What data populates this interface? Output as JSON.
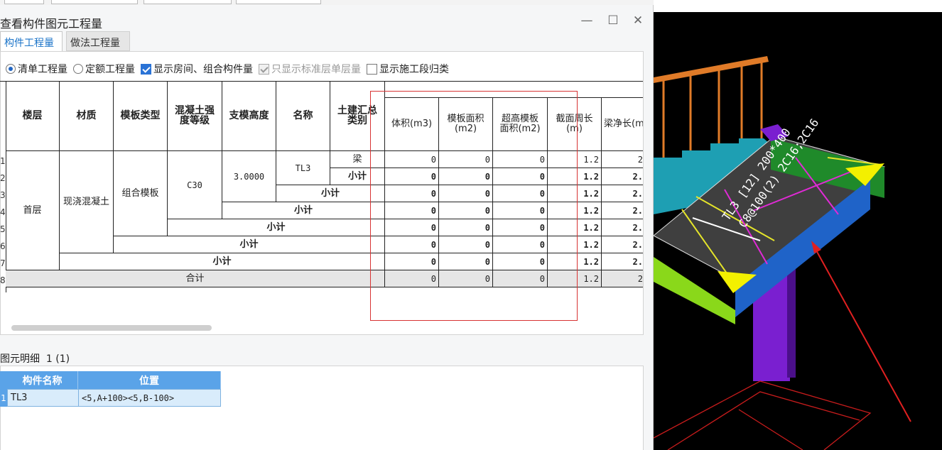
{
  "dialog": {
    "title": "查看构件图元工程量",
    "controls": {
      "minimize": "—",
      "maximize": "☐",
      "close": "✕"
    },
    "tabs": [
      "构件工程量",
      "做法工程量"
    ]
  },
  "options": {
    "radio_list": "清单工程量",
    "radio_quota": "定额工程量",
    "chk_show_room": "显示房间、组合构件量",
    "chk_std_floor": "只显示标准层单层量",
    "chk_construction": "显示施工段归类"
  },
  "table": {
    "headers": {
      "floor": "楼层",
      "material": "材质",
      "formwork_type": "模板类型",
      "concrete_grade": "混凝土强度等级",
      "support_height": "支模高度",
      "name": "名称",
      "category": "土建汇总类别",
      "volume": "体积(m3)",
      "formwork_area": "模板面积(m2)",
      "over_height_area": "超高模板面积(m2)",
      "section_perimeter": "截面周长(m)",
      "beam_net_length": "梁净长(m)"
    },
    "row_numbers": [
      "1",
      "2",
      "3",
      "4",
      "5",
      "6",
      "7",
      "8"
    ],
    "merged": {
      "floor": "首层",
      "material": "现浇混凝土",
      "formwork_type": "组合模板",
      "concrete_grade": "C30",
      "support_height": "3.0000",
      "name": "TL3",
      "category": "梁"
    },
    "subtotal": "小计",
    "total": "合计",
    "rows": [
      {
        "volume": "0",
        "formwork_area": "0",
        "over_height_area": "0",
        "section_perimeter": "1.2",
        "beam_net_length": "2"
      },
      {
        "volume": "0",
        "formwork_area": "0",
        "over_height_area": "0",
        "section_perimeter": "1.2",
        "beam_net_length": "2."
      },
      {
        "volume": "0",
        "formwork_area": "0",
        "over_height_area": "0",
        "section_perimeter": "1.2",
        "beam_net_length": "2."
      },
      {
        "volume": "0",
        "formwork_area": "0",
        "over_height_area": "0",
        "section_perimeter": "1.2",
        "beam_net_length": "2."
      },
      {
        "volume": "0",
        "formwork_area": "0",
        "over_height_area": "0",
        "section_perimeter": "1.2",
        "beam_net_length": "2."
      },
      {
        "volume": "0",
        "formwork_area": "0",
        "over_height_area": "0",
        "section_perimeter": "1.2",
        "beam_net_length": "2."
      },
      {
        "volume": "0",
        "formwork_area": "0",
        "over_height_area": "0",
        "section_perimeter": "1.2",
        "beam_net_length": "2."
      },
      {
        "volume": "0",
        "formwork_area": "0",
        "over_height_area": "0",
        "section_perimeter": "1.2",
        "beam_net_length": "2"
      }
    ]
  },
  "detail": {
    "title": "图元明细",
    "count": "1 (1)",
    "headers": [
      "构件名称",
      "位置"
    ],
    "row_no": "1",
    "row": {
      "name": "TL3",
      "position": "<5,A+100><5,B-100>"
    }
  },
  "viewport": {
    "beam_label_1": "TL3 [12] 200*400",
    "beam_label_2": "C8@100(2) 2C16;2C16"
  },
  "colors": {
    "tab_active": "#1a73c8",
    "header_blue": "#5aa3e8",
    "highlight_red": "#d83333",
    "viewport_bg": "#000000"
  }
}
